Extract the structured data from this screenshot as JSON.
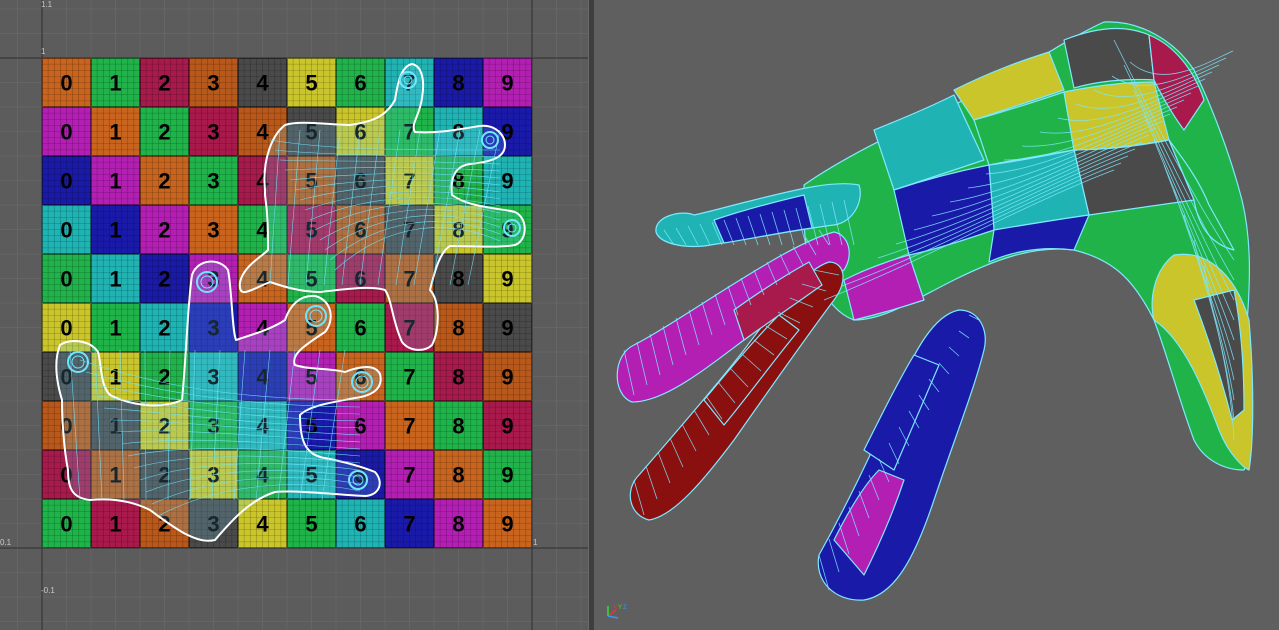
{
  "uv_editor": {
    "axis_labels": {
      "top_left": "1.1",
      "upper_left": "1",
      "lower_left": "-0.1",
      "left_mid": "0.1",
      "right_mid": "1"
    },
    "checker_rows": [
      [
        "0",
        "1",
        "2",
        "3",
        "4",
        "5",
        "6",
        "7",
        "8",
        "9"
      ],
      [
        "0",
        "1",
        "2",
        "3",
        "4",
        "5",
        "6",
        "7",
        "8",
        "9"
      ],
      [
        "0",
        "1",
        "2",
        "3",
        "4",
        "5",
        "6",
        "7",
        "8",
        "9"
      ],
      [
        "0",
        "1",
        "2",
        "3",
        "4",
        "5",
        "6",
        "7",
        "8",
        "9"
      ],
      [
        "0",
        "1",
        "2",
        "3",
        "4",
        "5",
        "6",
        "7",
        "8",
        "9"
      ],
      [
        "0",
        "1",
        "2",
        "3",
        "4",
        "5",
        "6",
        "7",
        "8",
        "9"
      ],
      [
        "0",
        "1",
        "2",
        "3",
        "4",
        "5",
        "6",
        "7",
        "8",
        "9"
      ],
      [
        "0",
        "1",
        "2",
        "3",
        "4",
        "5",
        "6",
        "7",
        "8",
        "9"
      ],
      [
        "0",
        "1",
        "2",
        "3",
        "4",
        "5",
        "6",
        "7",
        "8",
        "9"
      ],
      [
        "0",
        "1",
        "2",
        "3",
        "4",
        "5",
        "6",
        "7",
        "8",
        "9"
      ]
    ],
    "checker_colors": [
      [
        "#c8641e",
        "#1fb34a",
        "#a8194c",
        "#b8581a",
        "#4a4a4a",
        "#c9c52a",
        "#1fb34a",
        "#1fb3b3",
        "#1a1aa8",
        "#b31fb3"
      ],
      [
        "#b31fb3",
        "#c8641e",
        "#1fb34a",
        "#a8194c",
        "#b8581a",
        "#4a4a4a",
        "#c9c52a",
        "#1fb34a",
        "#1fb3b3",
        "#1a1aa8"
      ],
      [
        "#1a1aa8",
        "#b31fb3",
        "#c8641e",
        "#1fb34a",
        "#a8194c",
        "#b8581a",
        "#4a4a4a",
        "#c9c52a",
        "#1fb34a",
        "#1fb3b3"
      ],
      [
        "#1fb3b3",
        "#1a1aa8",
        "#b31fb3",
        "#c8641e",
        "#1fb34a",
        "#a8194c",
        "#b8581a",
        "#4a4a4a",
        "#c9c52a",
        "#1fb34a"
      ],
      [
        "#1fb34a",
        "#1fb3b3",
        "#1a1aa8",
        "#b31fb3",
        "#c8641e",
        "#1fb34a",
        "#a8194c",
        "#b8581a",
        "#4a4a4a",
        "#c9c52a"
      ],
      [
        "#c9c52a",
        "#1fb34a",
        "#1fb3b3",
        "#1a1aa8",
        "#b31fb3",
        "#c8641e",
        "#1fb34a",
        "#a8194c",
        "#b8581a",
        "#4a4a4a"
      ],
      [
        "#4a4a4a",
        "#c9c52a",
        "#1fb34a",
        "#1fb3b3",
        "#1a1aa8",
        "#b31fb3",
        "#c8641e",
        "#1fb34a",
        "#a8194c",
        "#b8581a"
      ],
      [
        "#b8581a",
        "#4a4a4a",
        "#c9c52a",
        "#1fb34a",
        "#1fb3b3",
        "#1a1aa8",
        "#b31fb3",
        "#c8641e",
        "#1fb34a",
        "#a8194c"
      ],
      [
        "#a8194c",
        "#b8581a",
        "#4a4a4a",
        "#c9c52a",
        "#1fb34a",
        "#1fb3b3",
        "#1a1aa8",
        "#b31fb3",
        "#c8641e",
        "#1fb34a"
      ],
      [
        "#1fb34a",
        "#a8194c",
        "#b8581a",
        "#4a4a4a",
        "#c9c52a",
        "#1fb34a",
        "#1fb3b3",
        "#1a1aa8",
        "#b31fb3",
        "#c8641e"
      ]
    ],
    "shell_border_color": "#ffffff",
    "wire_color": "#6fe6ff"
  },
  "viewport": {
    "axis_gizmo": {
      "x": "X",
      "y": "Y",
      "z": "Z"
    },
    "wire_color": "#7fe8ff",
    "hand_colors": [
      "#1fb3b3",
      "#1a1aa8",
      "#b31fb3",
      "#8a1010",
      "#1fb34a",
      "#c9c52a",
      "#4a4a4a",
      "#a8194c"
    ]
  }
}
